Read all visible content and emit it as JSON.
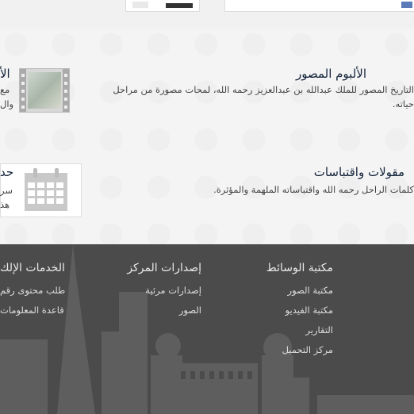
{
  "sections": {
    "album": {
      "title": "الألبوم المصور",
      "desc_line1": "التاريخ المصور للملك عبدالله بن عبدالعزيز رحمه الله، لمحات مصورة من مراحل",
      "desc_line2": "حياته."
    },
    "album_left_partial": {
      "title": "الأ",
      "line1": "مع",
      "line2": "وال"
    },
    "quotes": {
      "title": "مقولات واقتباسات",
      "desc": "كلمات الراحل رحمه الله واقتباساته الملهمة والمؤثرة."
    },
    "quotes_left_partial": {
      "title": "حد",
      "line1": "سر",
      "line2": "هذ"
    }
  },
  "footer": {
    "media_library": {
      "heading": "مكتبة الوسائط",
      "links": [
        "مكتبة الصور",
        "مكتبة الفيديو",
        "التقارير",
        "مركز التحميل"
      ]
    },
    "center_publications": {
      "heading": "إصدارات المركز",
      "links": [
        "إصدارات مرئية",
        "الصور"
      ]
    },
    "e_services": {
      "heading": "الخدمات الإلك",
      "links": [
        "طلب محتوى رقم",
        "قاعدة المعلومات"
      ]
    }
  },
  "icons": {
    "album": "film-strip-icon",
    "quotes": "calendar-icon"
  },
  "colors": {
    "heading_dark": "#14233b",
    "footer_bg": "#4b4b4b",
    "skyline": "#5f5f5f"
  }
}
